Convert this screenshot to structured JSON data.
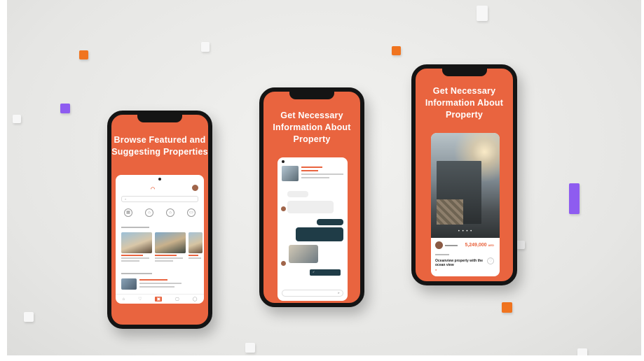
{
  "colors": {
    "brand": "#e9643f",
    "dark_accent": "#1f3c47",
    "cube_orange": "#f0741f",
    "cube_purple": "#8e5cf0"
  },
  "phones": [
    {
      "title_line1": "Browse Featured and",
      "title_line2": "Suggesting Properties"
    },
    {
      "title_line1": "Get Necessary",
      "title_line2": "Information About",
      "title_line3": "Property"
    },
    {
      "title_line1": "Get Necessary",
      "title_line2": "Information About",
      "title_line3": "Property",
      "price": "5,249,000",
      "price_unit": "AED",
      "property_name": "Oceanview property with the ocean view"
    }
  ],
  "icons": {
    "cat1": "building-icon",
    "cat2": "house-icon",
    "cat3": "villa-icon",
    "cat4": "land-icon",
    "heart": "heart-icon"
  }
}
